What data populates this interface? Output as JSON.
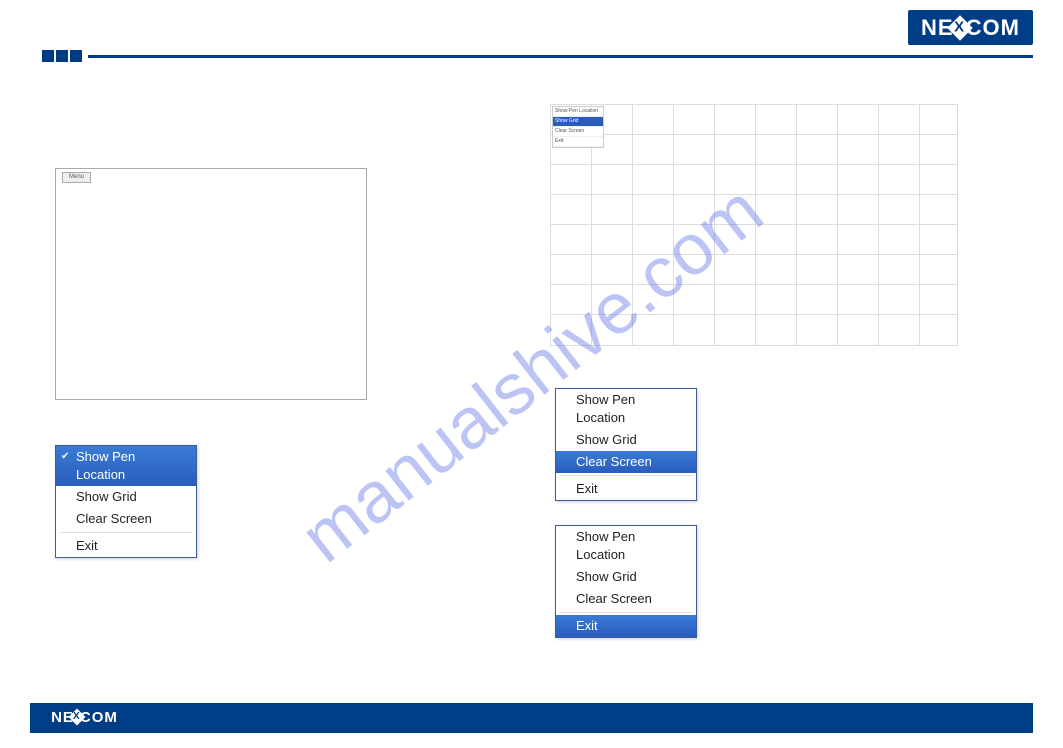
{
  "branding": {
    "logo_pre": "NE",
    "logo_x": "X",
    "logo_post": "COM"
  },
  "watermark": "manualshive.com",
  "panel_left": {
    "menu_label": "Menu"
  },
  "mini_menu": {
    "title": "Show Pen Location",
    "grid": "Show Grid",
    "clear": "Clear Screen",
    "exit": "Exit"
  },
  "popup_common": {
    "spl": "Show Pen Location",
    "grid": "Show Grid",
    "clear": "Clear Screen",
    "exit": "Exit"
  }
}
